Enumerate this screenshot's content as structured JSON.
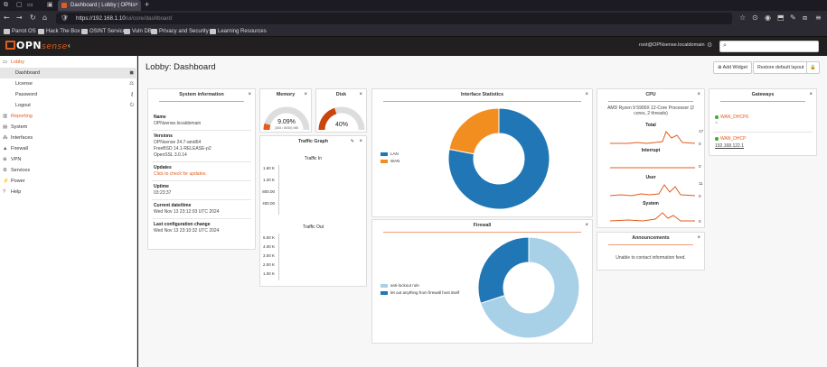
{
  "browser": {
    "tab_title": "Dashboard | Lobby | OPNs",
    "url_host": "https://192.168.1.10",
    "url_path": "/ui/core/dashboard",
    "bookmarks": [
      "Parrot OS",
      "Hack The Box",
      "OSINT Services",
      "Vuln DB",
      "Privacy and Security",
      "Learning Resources"
    ]
  },
  "header": {
    "logo_prefix": "OPN",
    "logo_suffix": "sense",
    "user": "root@OPNsense.localdomain"
  },
  "sidebar": {
    "lobby": "Lobby",
    "sub": [
      "Dashboard",
      "License",
      "Password",
      "Logout"
    ],
    "items": [
      "Reporting",
      "System",
      "Interfaces",
      "Firewall",
      "VPN",
      "Services",
      "Power",
      "Help"
    ]
  },
  "page": {
    "title": "Lobby: Dashboard",
    "add_widget": "Add Widget",
    "restore_layout": "Restore default layout"
  },
  "system_info": {
    "title": "System information",
    "name_label": "Name",
    "name_value": "OPNsense.localdomain",
    "versions_label": "Versions",
    "versions": [
      "OPNsense 24.7-amd64",
      "FreeBSD 14.1-RELEASE-p2",
      "OpenSSL 3.0.14"
    ],
    "updates_label": "Updates",
    "updates_value": "Click to check for updates.",
    "uptime_label": "Uptime",
    "uptime_value": "03:23:37",
    "date_label": "Current date/time",
    "date_value": "Wed Nov 13 23:12:03 UTC 2024",
    "lastconf_label": "Last configuration change",
    "lastconf_value": "Wed Nov 13 23:10:32 UTC 2024"
  },
  "memory": {
    "title": "Memory",
    "percent": "9.09%",
    "detail": "(365 / 8050) MB",
    "fraction": 0.0909
  },
  "disk": {
    "title": "Disk",
    "percent": "40%",
    "fraction": 0.4
  },
  "traffic": {
    "title": "Traffic Graph",
    "in_label": "Traffic In",
    "in_ticks": [
      "1.60 K",
      "1.20 K",
      "800.00",
      "400.00"
    ],
    "out_label": "Traffic Out",
    "out_ticks": [
      "5.00 K",
      "4.00 K",
      "3.00 K",
      "2.00 K",
      "1.00 K"
    ]
  },
  "iface_stats": {
    "title": "Interface Statistics",
    "legend": [
      {
        "name": "LAN",
        "color": "#2176b5"
      },
      {
        "name": "WAN",
        "color": "#f28e1f"
      }
    ],
    "fractions": [
      0.78,
      0.22
    ]
  },
  "firewall": {
    "title": "Firewall",
    "legend": [
      {
        "name": "anti-lockout rule",
        "color": "#a8d0e6"
      },
      {
        "name": "let out anything from firewall host itself",
        "color": "#2176b5"
      }
    ],
    "fractions": [
      0.7,
      0.3
    ]
  },
  "cpu": {
    "title": "CPU",
    "model": "AMD Ryzen 9 5900X 12-Core Processor (2 cores, 2 threads)",
    "graphs": [
      {
        "name": "Total",
        "max": "17",
        "min": "0"
      },
      {
        "name": "Interrupt",
        "max": "",
        "min": "0"
      },
      {
        "name": "User",
        "max": "11",
        "min": "0"
      },
      {
        "name": "System",
        "max": "",
        "min": "0"
      }
    ]
  },
  "announcements": {
    "title": "Announcements",
    "message": "Unable to contact information feed."
  },
  "gateways": {
    "title": "Gateways",
    "items": [
      {
        "name": "WAN_DHCP6",
        "addr": "~"
      },
      {
        "name": "WAN_DHCP",
        "addr": "192.168.122.1"
      }
    ]
  }
}
